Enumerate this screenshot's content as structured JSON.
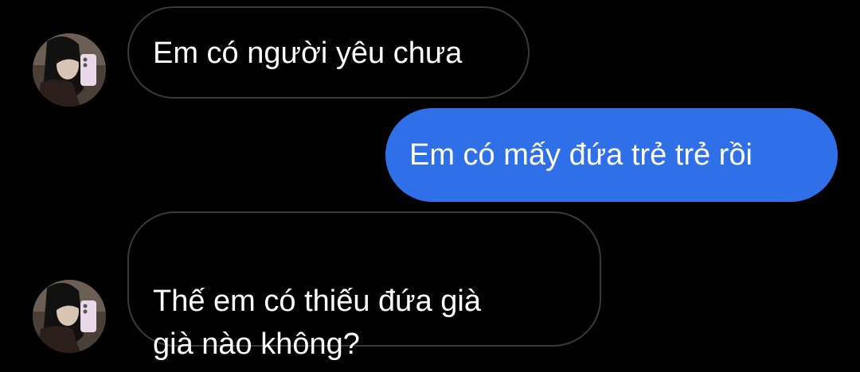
{
  "colors": {
    "background": "#000000",
    "incoming_bubble_border": "#3a3a3c",
    "outgoing_bubble": "#2f6fe8",
    "text": "#ffffff"
  },
  "messages": [
    {
      "direction": "incoming",
      "text": "Em có người yêu chưa",
      "avatar": "contact-avatar-photo"
    },
    {
      "direction": "outgoing",
      "text": "Em có mấy đứa trẻ trẻ rồi"
    },
    {
      "direction": "incoming",
      "text": "Thế em có thiếu đứa già\ngià nào không?",
      "avatar": "contact-avatar-photo"
    }
  ]
}
